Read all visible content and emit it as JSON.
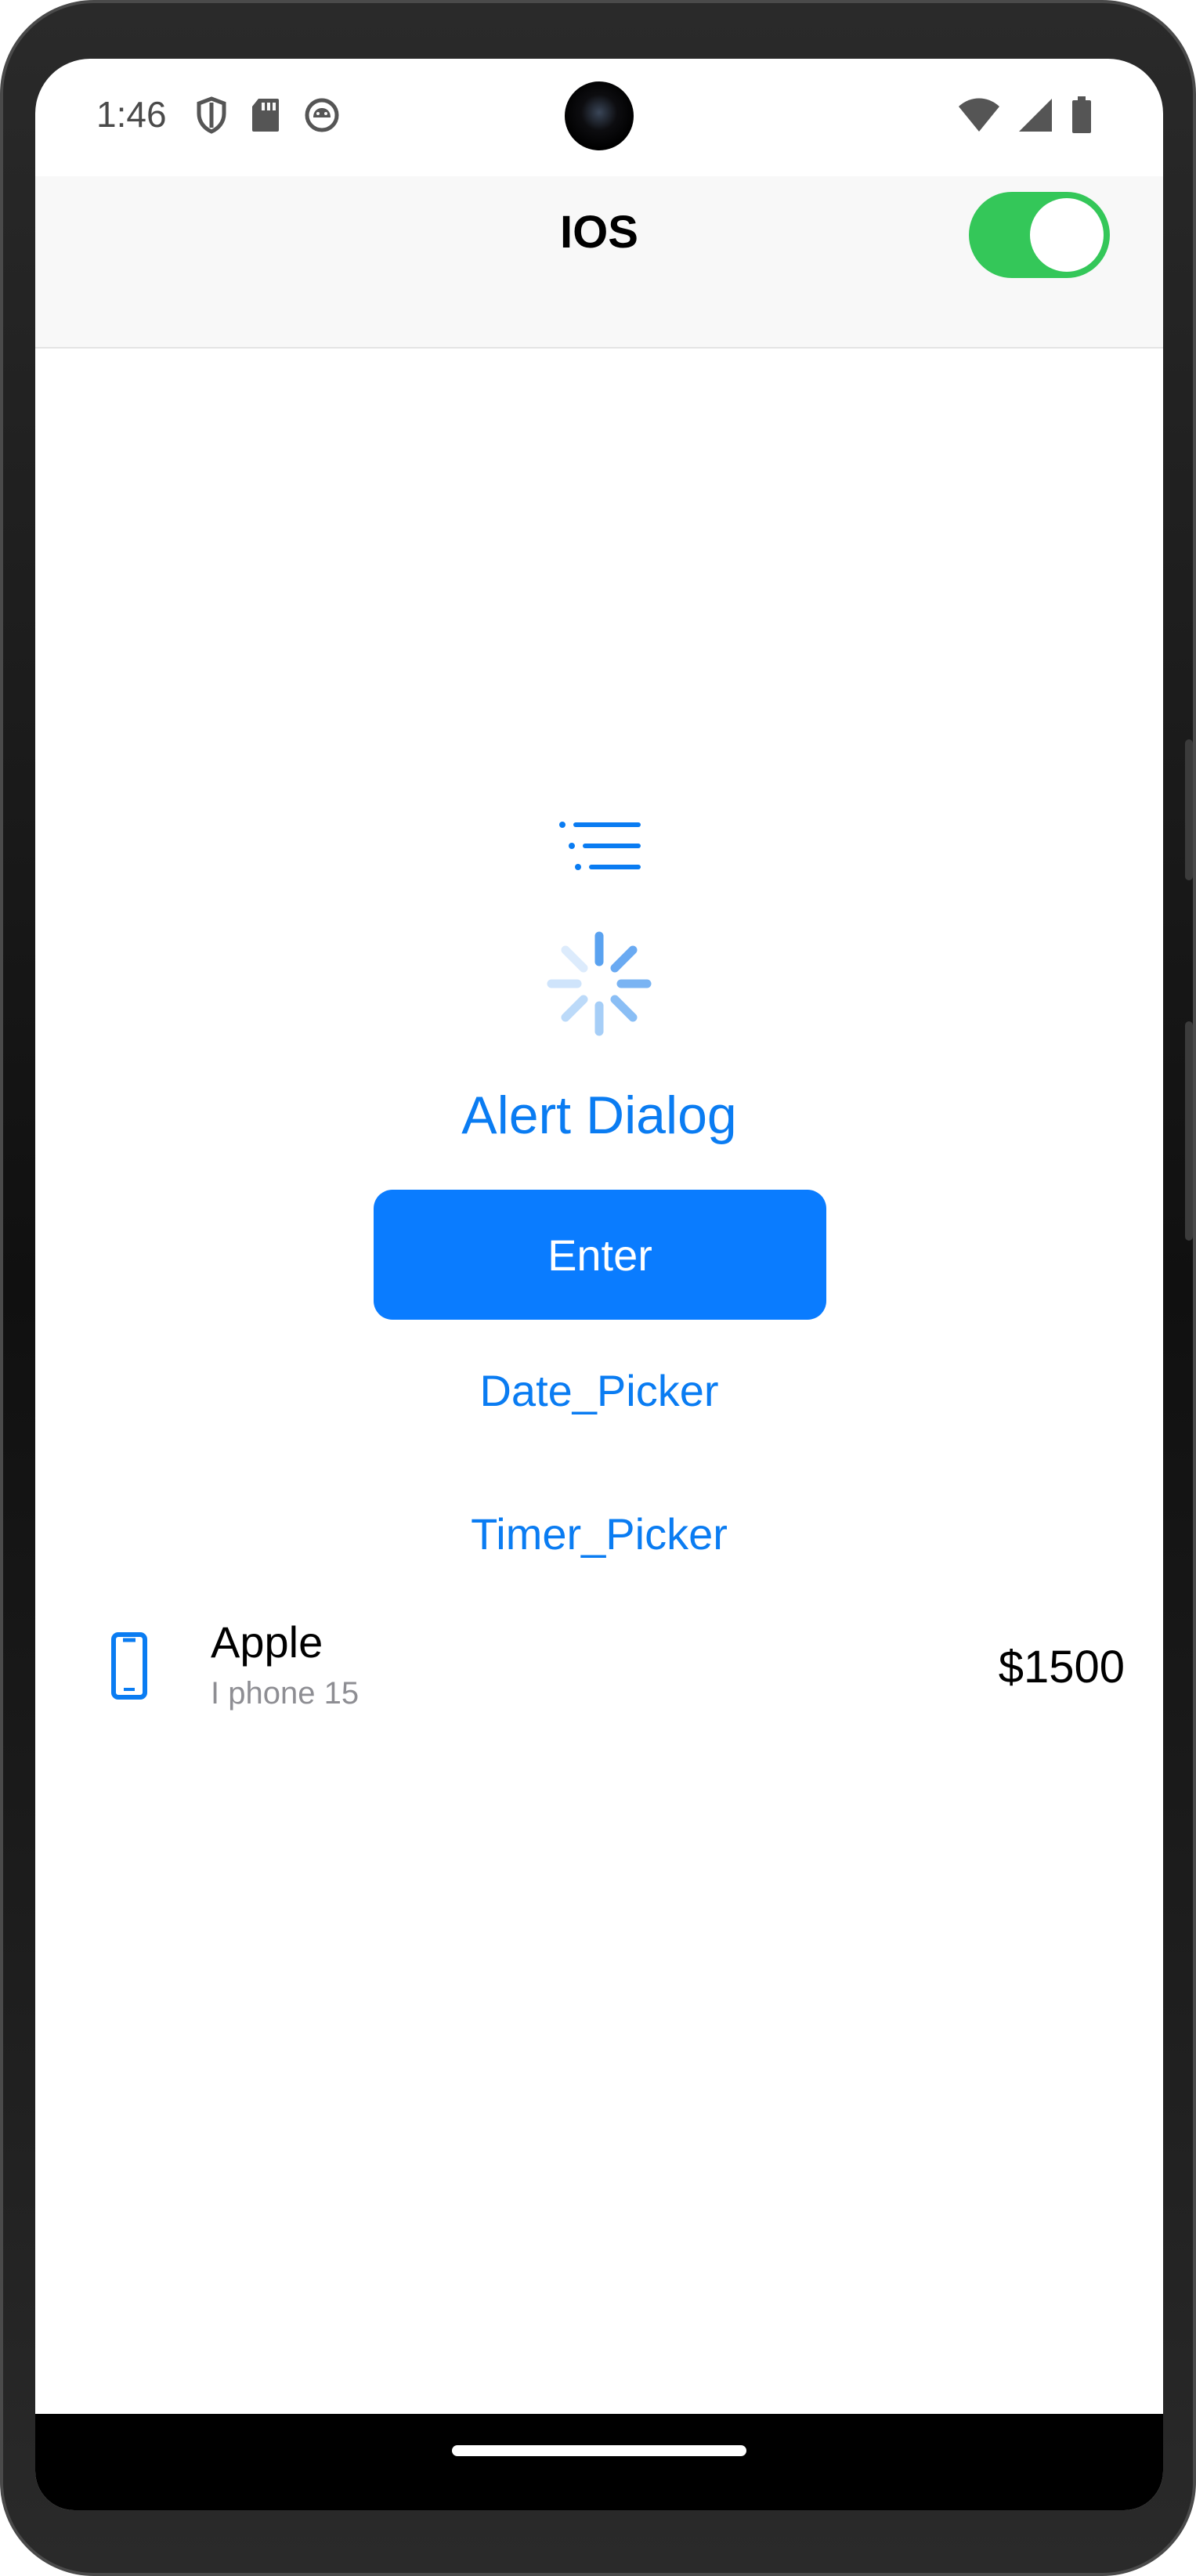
{
  "status_bar": {
    "time": "1:46",
    "left_icons": [
      "shield-icon",
      "sd-card-icon",
      "android-debug-icon"
    ],
    "right_icons": [
      "wifi-icon",
      "signal-icon",
      "battery-icon"
    ]
  },
  "app_bar": {
    "title": "IOS",
    "toggle_on": true,
    "toggle_color": "#34c759"
  },
  "main": {
    "list_icon": "list-icon",
    "spinner_icon": "activity-indicator-icon",
    "alert_label": "Alert Dialog",
    "enter_label": "Enter",
    "date_picker_label": "Date_Picker",
    "timer_picker_label": "Timer_Picker"
  },
  "list_item": {
    "icon": "phone-icon",
    "title": "Apple",
    "subtitle": "I phone 15",
    "price": "$1500"
  },
  "colors": {
    "accent": "#0a7cff",
    "link": "#0a7cf2",
    "toggle": "#34c759"
  }
}
